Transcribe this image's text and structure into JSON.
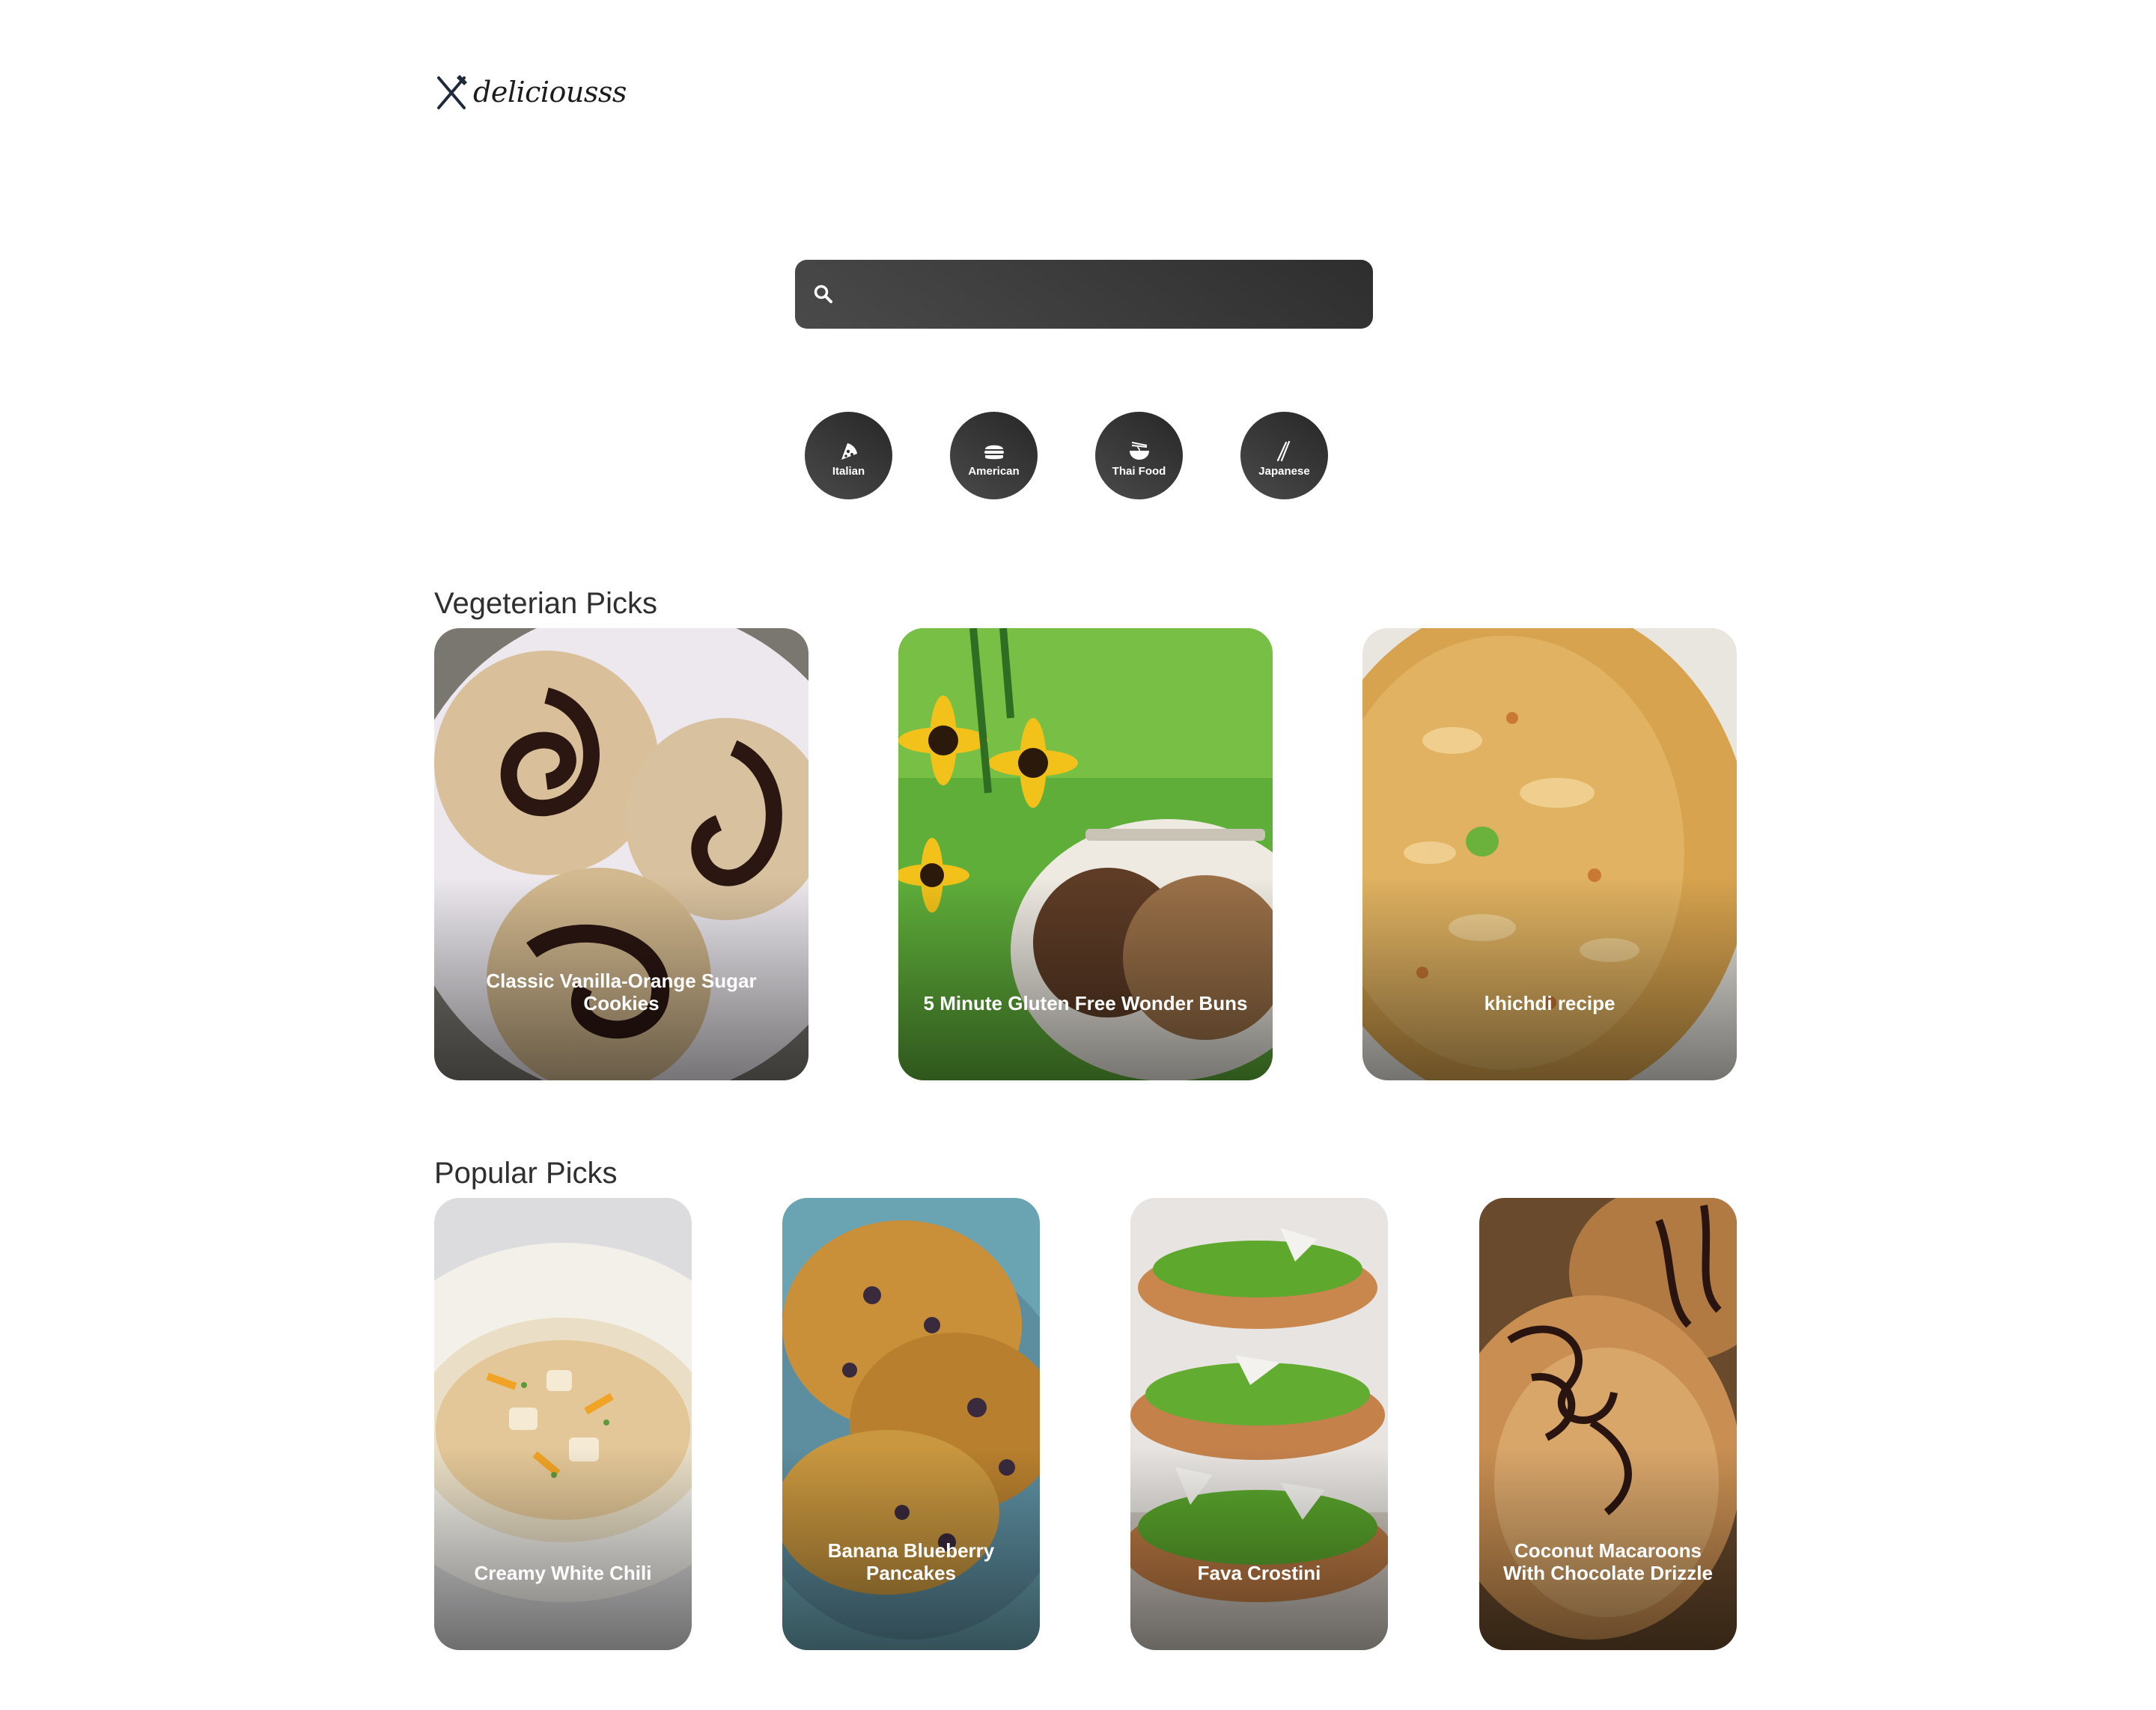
{
  "logo": {
    "text": "deliciousss",
    "icon": "fork-knife-icon"
  },
  "search": {
    "placeholder": "",
    "value": "",
    "icon": "search-icon"
  },
  "categories": [
    {
      "label": "Italian",
      "icon": "pizza-icon"
    },
    {
      "label": "American",
      "icon": "burger-icon"
    },
    {
      "label": "Thai Food",
      "icon": "noodle-bowl-icon"
    },
    {
      "label": "Japanese",
      "icon": "chopsticks-icon"
    }
  ],
  "veggie": {
    "title": "Vegeterian Picks",
    "cards": [
      {
        "title": "Classic Vanilla-Orange Sugar Cookies"
      },
      {
        "title": "5 Minute Gluten Free Wonder Buns"
      },
      {
        "title": "khichdi recipe"
      }
    ]
  },
  "popular": {
    "title": "Popular Picks",
    "cards": [
      {
        "title": "Creamy White Chili"
      },
      {
        "title": "Banana Blueberry Pancakes"
      },
      {
        "title": "Fava Crostini"
      },
      {
        "title": "Coconut Macaroons With Chocolate Drizzle"
      }
    ]
  },
  "colors": {
    "accent_dark": "#333333",
    "text": "#2f2f2f",
    "background": "#ffffff"
  }
}
